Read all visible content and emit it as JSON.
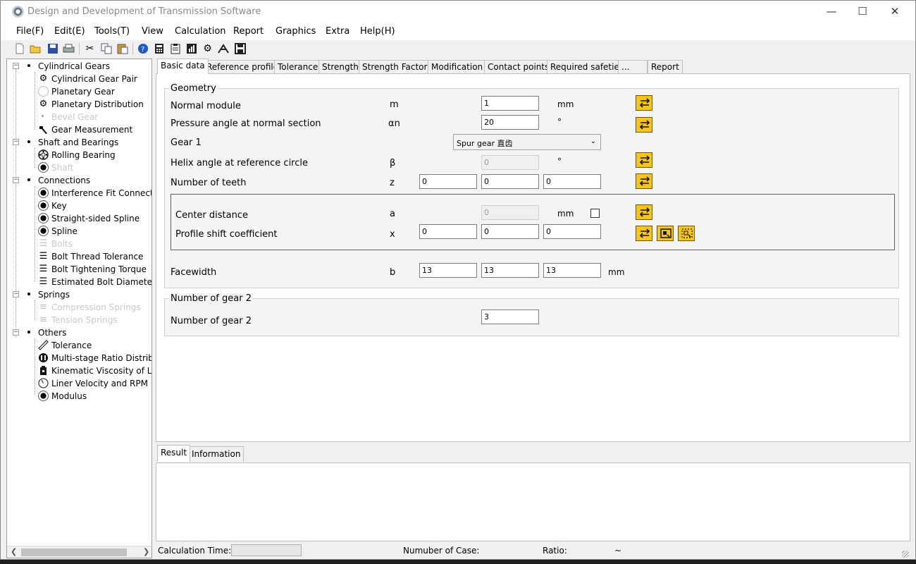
{
  "window": {
    "title": "Design and Development of Transmission Software"
  },
  "menu": [
    "File(F)",
    "Edit(E)",
    "Tools(T)",
    "View",
    "Calculation",
    "Report",
    "Graphics",
    "Extra",
    "Help(H)"
  ],
  "toolbar": [
    "new-file-icon",
    "open-folder-icon",
    "save-icon",
    "print-icon",
    "cut-icon",
    "copy-icon",
    "paste-icon",
    "help-icon",
    "calculator-icon",
    "clipboard-icon",
    "chart-icon",
    "settings-gear-icon",
    "measure-icon",
    "disk-icon"
  ],
  "tree": {
    "groups": [
      {
        "label": "Cylindrical Gears",
        "children": [
          {
            "label": "Cylindrical Gear Pair",
            "icon": "gear-pair-icon",
            "enabled": true
          },
          {
            "label": "Planetary Gear",
            "icon": "planetary-gear-icon",
            "enabled": true
          },
          {
            "label": "Planetary Distribution",
            "icon": "gears-icon",
            "enabled": true
          },
          {
            "label": "Bevel Gear",
            "icon": "bevel-gear-icon",
            "enabled": false
          },
          {
            "label": "Gear Measurement",
            "icon": "hammer-icon",
            "enabled": true
          }
        ]
      },
      {
        "label": "Shaft and Bearings",
        "children": [
          {
            "label": "Rolling Bearing",
            "icon": "bearing-icon",
            "enabled": true
          },
          {
            "label": "Shaft",
            "icon": "shaft-icon",
            "enabled": false
          }
        ]
      },
      {
        "label": "Connections",
        "children": [
          {
            "label": "Interference Fit Connection",
            "icon": "interference-fit-icon",
            "enabled": true
          },
          {
            "label": "Key",
            "icon": "key-icon",
            "enabled": true
          },
          {
            "label": "Straight-sided Spline",
            "icon": "straight-spline-icon",
            "enabled": true
          },
          {
            "label": "Spline",
            "icon": "spline-icon",
            "enabled": true
          },
          {
            "label": "Bolts",
            "icon": "bolt-icon",
            "enabled": false
          },
          {
            "label": "Bolt Thread Tolerance",
            "icon": "bolt-thread-icon",
            "enabled": true
          },
          {
            "label": "Bolt Tightening Torque",
            "icon": "bolt-torque-icon",
            "enabled": true
          },
          {
            "label": "Estimated Bolt Diameter",
            "icon": "bolt-diameter-icon",
            "enabled": true
          }
        ]
      },
      {
        "label": "Springs",
        "children": [
          {
            "label": "Compression Springs",
            "icon": "compression-spring-icon",
            "enabled": false
          },
          {
            "label": "Tension Springs",
            "icon": "tension-spring-icon",
            "enabled": false
          }
        ]
      },
      {
        "label": "Others",
        "children": [
          {
            "label": "Tolerance",
            "icon": "ruler-icon",
            "enabled": true
          },
          {
            "label": "Multi-stage Ratio Distributi",
            "icon": "multi-stage-icon",
            "enabled": true
          },
          {
            "label": "Kinematic Viscosity of Lubr",
            "icon": "oil-can-icon",
            "enabled": true
          },
          {
            "label": "Liner Velocity and RPM",
            "icon": "gauge-icon",
            "enabled": true
          },
          {
            "label": "Modulus",
            "icon": "modulus-icon",
            "enabled": true
          }
        ]
      }
    ]
  },
  "tabs": [
    "Basic data",
    "Reference profile",
    "Tolerance",
    "Strength",
    "Strength Factors",
    "Modification",
    "Contact points",
    "Required safeties",
    "...",
    "Report"
  ],
  "active_tab": "Basic data",
  "geometry": {
    "title": "Geometry",
    "normal_module": {
      "label": "Normal module",
      "symbol": "m",
      "value": "1",
      "unit": "mm"
    },
    "pressure_angle": {
      "label": "Pressure angle at normal section",
      "symbol": "αn",
      "value": "20",
      "unit": "°"
    },
    "gear1": {
      "label": "Gear 1",
      "selected": "Spur gear 直齿"
    },
    "helix_angle": {
      "label": "Helix angle at reference circle",
      "symbol": "β",
      "value": "0",
      "unit": "°"
    },
    "teeth": {
      "label": "Number of teeth",
      "symbol": "z",
      "values": [
        "0",
        "0",
        "0"
      ]
    },
    "center_distance": {
      "label": "Center distance",
      "symbol": "a",
      "value": "0",
      "unit": "mm"
    },
    "profile_shift": {
      "label": "Profile shift coefficient",
      "symbol": "x",
      "values": [
        "0",
        "0",
        "0"
      ]
    },
    "facewidth": {
      "label": "Facewidth",
      "symbol": "b",
      "values": [
        "13",
        "13",
        "13"
      ],
      "unit": "mm"
    }
  },
  "gear2_group": {
    "title": "Number of gear 2",
    "label": "Number of gear 2",
    "value": "3"
  },
  "result_tabs": [
    "Result",
    "Information"
  ],
  "status": {
    "calc_time_label": "Calculation Time:",
    "case_label": "Numuber of Case:",
    "ratio_label": "Ratio:",
    "ratio_value": "~"
  },
  "colors": {
    "accent_button": "#f5c518",
    "window_bg": "#f0f0f0"
  }
}
